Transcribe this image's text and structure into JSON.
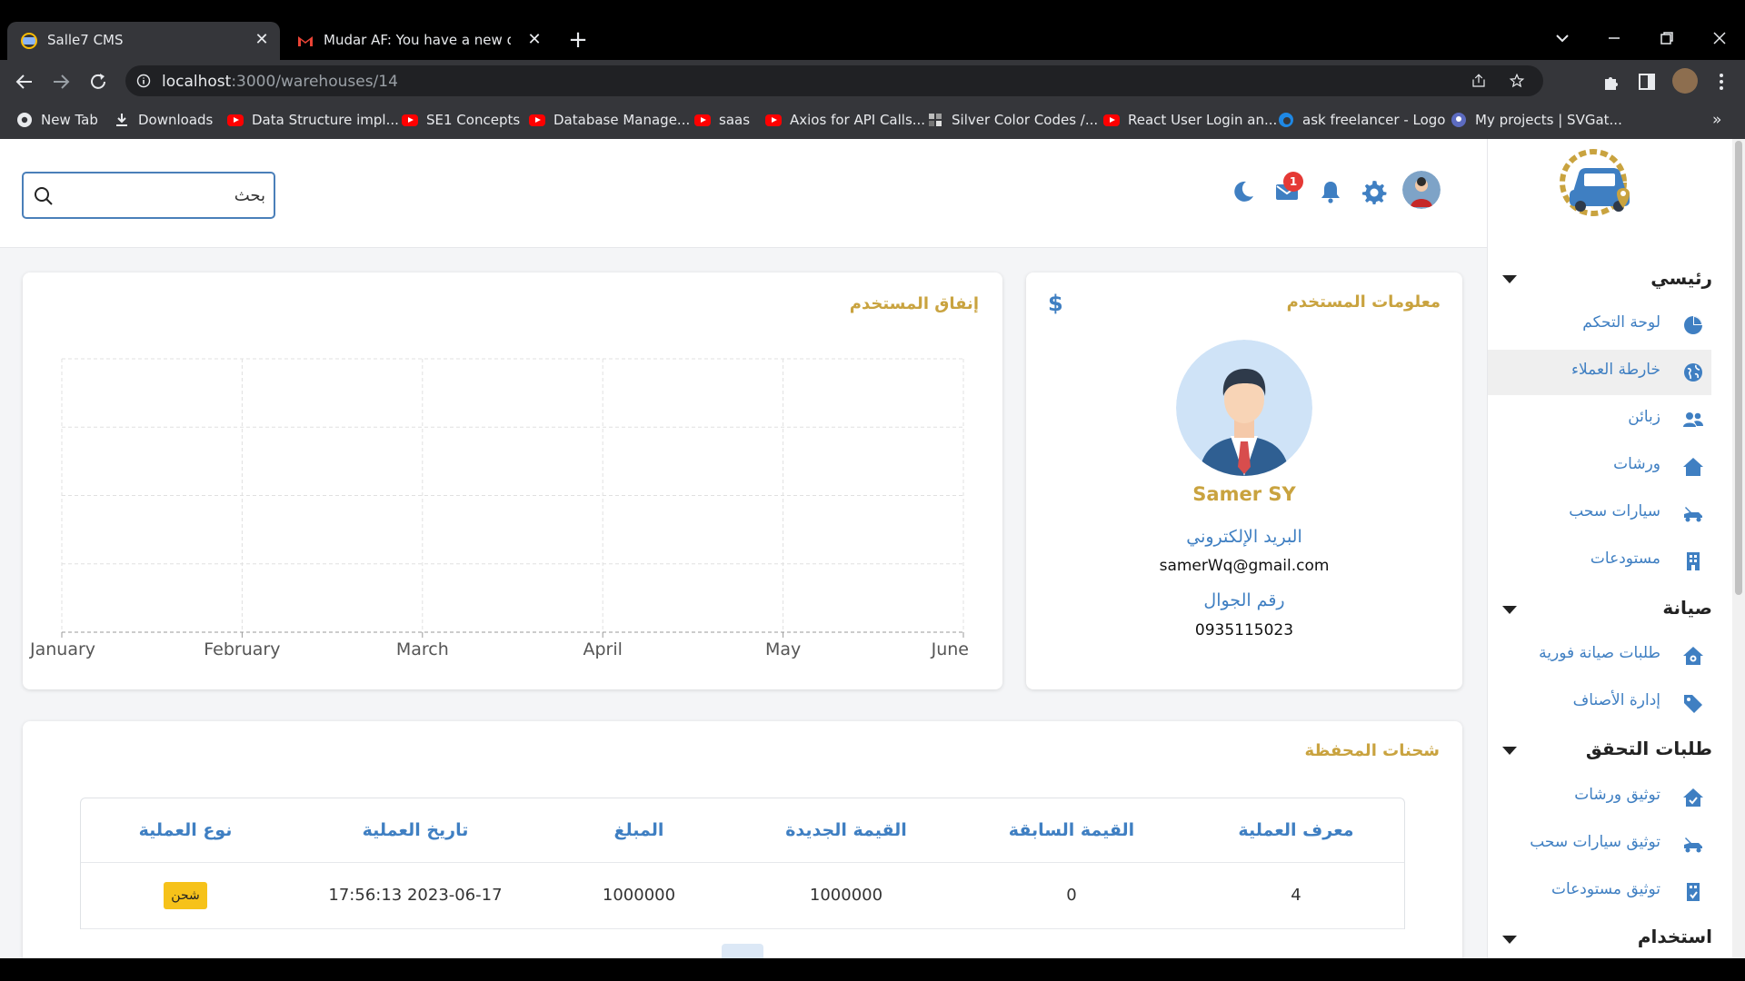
{
  "browser": {
    "tabs": [
      {
        "title": "Salle7 CMS",
        "active": true
      },
      {
        "title": "Mudar AF: You have a new query",
        "active": false
      }
    ],
    "url_host": "localhost",
    "url_path": ":3000/warehouses/14",
    "bookmarks": [
      {
        "label": "New Tab",
        "icon": "chrome-icon"
      },
      {
        "label": "Downloads",
        "icon": "download-icon"
      },
      {
        "label": "Data Structure impl...",
        "icon": "youtube-icon"
      },
      {
        "label": "SE1 Concepts",
        "icon": "youtube-icon"
      },
      {
        "label": "Database Manage...",
        "icon": "youtube-icon"
      },
      {
        "label": "saas",
        "icon": "youtube-icon"
      },
      {
        "label": "Axios for API Calls...",
        "icon": "youtube-icon"
      },
      {
        "label": "Silver Color Codes /...",
        "icon": "color-grid-icon"
      },
      {
        "label": "React User Login an...",
        "icon": "youtube-icon"
      },
      {
        "label": "ask freelancer - Logo",
        "icon": "edge-icon"
      },
      {
        "label": "My projects | SVGat...",
        "icon": "svgator-icon"
      }
    ],
    "more_bookmarks": "»"
  },
  "topbar": {
    "search_placeholder": "بحث",
    "mail_badge": "1",
    "icons": [
      "dark-mode-icon",
      "mail-icon",
      "bell-icon",
      "settings-icon",
      "profile-avatar"
    ]
  },
  "user_card": {
    "title": "معلومات المستخدم",
    "currency_icon": "$",
    "name": "Samer SY",
    "email_label": "البريد الإلكتروني",
    "email": "samerWq@gmail.com",
    "phone_label": "رقم الجوال",
    "phone": "0935115023"
  },
  "spend_card": {
    "title": "إنفاق المستخدم"
  },
  "chart_data": {
    "type": "line",
    "x": [
      "January",
      "February",
      "March",
      "April",
      "May",
      "June"
    ],
    "series": [],
    "grid": true,
    "title": "",
    "xlabel": "",
    "ylabel": ""
  },
  "shipments": {
    "title": "شحنات المحفظة",
    "columns": [
      "معرف العملية",
      "القيمة السابقة",
      "القيمة الجديدة",
      "المبلغ",
      "تاريخ العملية",
      "نوع العملية"
    ],
    "rows": [
      {
        "id": "4",
        "previous": "0",
        "new": "1000000",
        "amount": "1000000",
        "date": "17:56:13 2023-06-17",
        "type": "شحن"
      }
    ]
  },
  "sidebar": {
    "sections": [
      {
        "title": "رئيسي",
        "items": [
          {
            "label": "لوحة التحكم",
            "icon": "pie-chart-icon"
          },
          {
            "label": "خارطة العملاء",
            "icon": "globe-icon",
            "active": true
          },
          {
            "label": "زبائن",
            "icon": "users-icon"
          },
          {
            "label": "ورشات",
            "icon": "house-icon"
          },
          {
            "label": "سيارات سحب",
            "icon": "tow-truck-icon"
          },
          {
            "label": "مستودعات",
            "icon": "building-icon"
          }
        ]
      },
      {
        "title": "صيانة",
        "items": [
          {
            "label": "طلبات صيانة فورية",
            "icon": "house-wrench-icon"
          },
          {
            "label": "إدارة الأصناف",
            "icon": "tag-icon"
          }
        ]
      },
      {
        "title": "طلبات التحقق",
        "items": [
          {
            "label": "توثيق ورشات",
            "icon": "house-check-icon"
          },
          {
            "label": "توثيق سيارات سحب",
            "icon": "tow-truck-check-icon"
          },
          {
            "label": "توثيق مستودعات",
            "icon": "building-check-icon"
          }
        ]
      },
      {
        "title": "استخدام",
        "items": []
      }
    ]
  },
  "colors": {
    "accent": "#3f7fc2",
    "gold": "#c9a33f",
    "badge": "#f6c21a"
  }
}
